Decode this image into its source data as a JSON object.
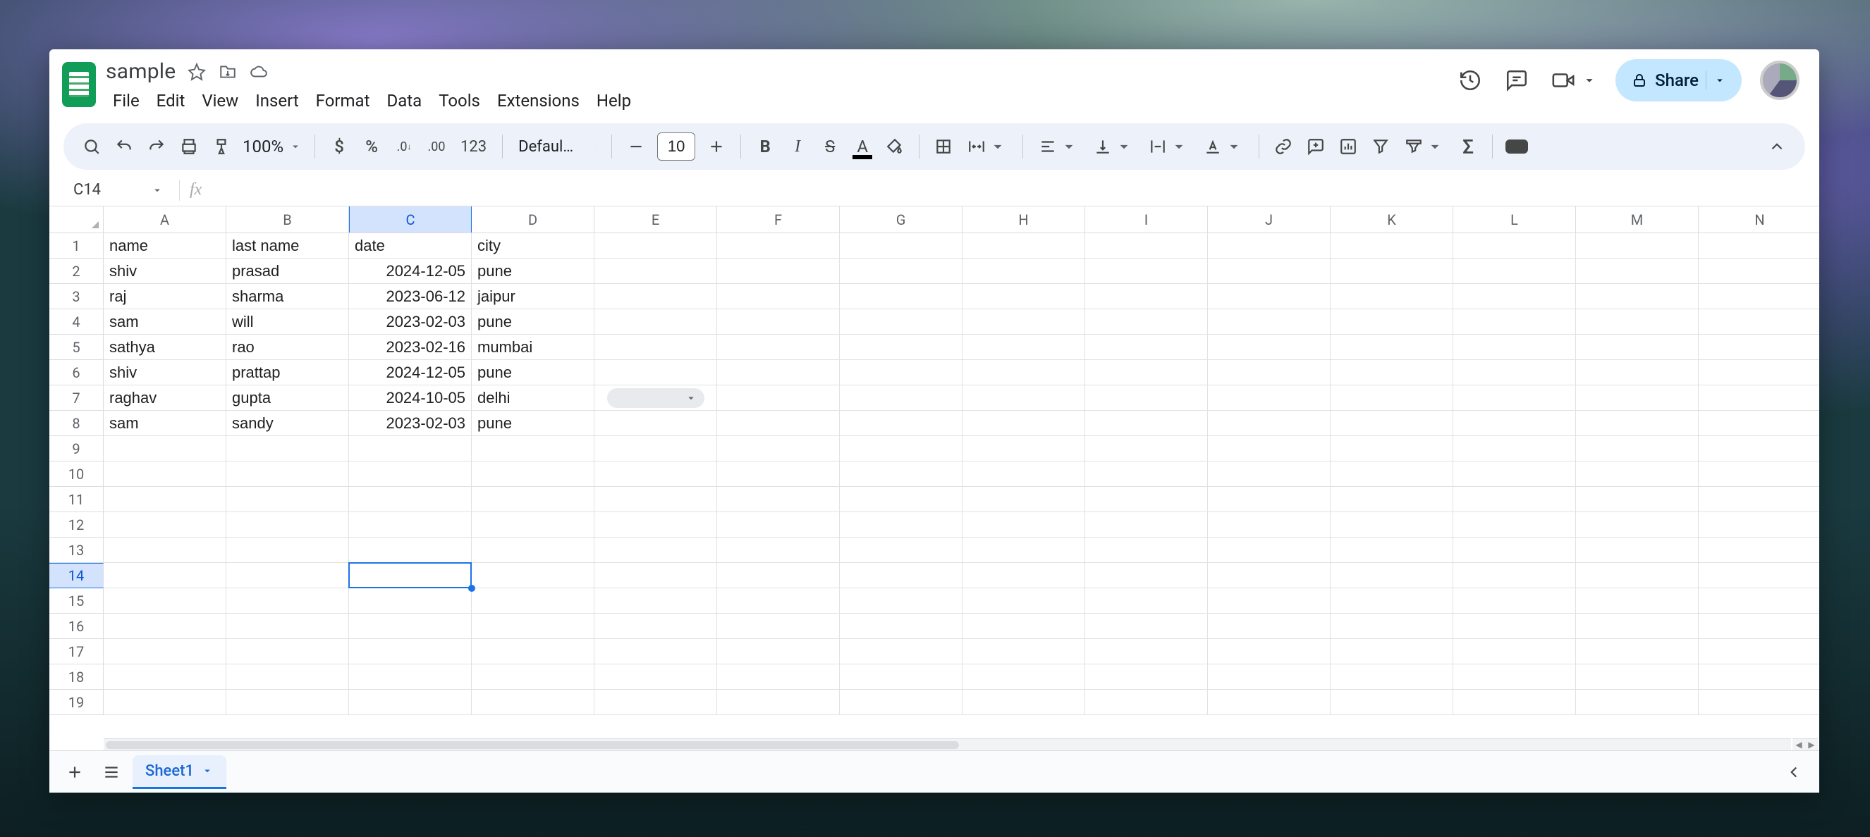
{
  "document": {
    "title": "sample"
  },
  "menus": [
    "File",
    "Edit",
    "View",
    "Insert",
    "Format",
    "Data",
    "Tools",
    "Extensions",
    "Help"
  ],
  "share_label": "Share",
  "toolbar": {
    "zoom": "100%",
    "font": "Defaul…",
    "font_size": "10"
  },
  "namebox": {
    "ref": "C14"
  },
  "columns": [
    "A",
    "B",
    "C",
    "D",
    "E",
    "F",
    "G",
    "H",
    "I",
    "J",
    "K",
    "L",
    "M",
    "N"
  ],
  "rows": [
    "1",
    "2",
    "3",
    "4",
    "5",
    "6",
    "7",
    "8",
    "9",
    "10",
    "11",
    "12",
    "13",
    "14",
    "15",
    "16",
    "17",
    "18",
    "19"
  ],
  "selected": {
    "row_index": 13,
    "col_index": 2
  },
  "chart_data": {
    "type": "table",
    "headers": [
      "name",
      "last name",
      "date",
      "city"
    ],
    "rows": [
      [
        "shiv",
        "prasad",
        "2024-12-05",
        "pune"
      ],
      [
        "raj",
        "sharma",
        "2023-06-12",
        "jaipur"
      ],
      [
        "sam",
        "will",
        "2023-02-03",
        "pune"
      ],
      [
        "sathya",
        "rao",
        "2023-02-16",
        "mumbai"
      ],
      [
        "shiv",
        "prattap",
        "2024-12-05",
        "pune"
      ],
      [
        "raghav",
        "gupta",
        "2024-10-05",
        "delhi"
      ],
      [
        "sam",
        "sandy",
        "2023-02-03",
        "pune"
      ]
    ]
  },
  "dropdown_chip": {
    "row": 6,
    "col": 4
  },
  "sheet_tab": "Sheet1"
}
